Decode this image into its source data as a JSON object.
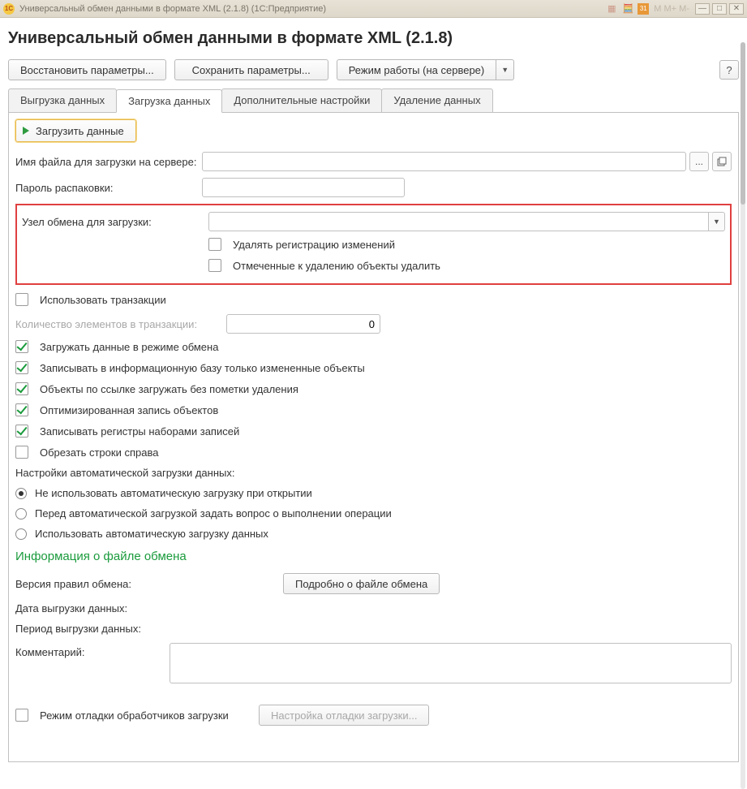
{
  "titlebar": {
    "logo_text": "1C",
    "title": "Универсальный обмен данными в формате XML (2.1.8)  (1С:Предприятие)",
    "m_text": "M  M+ M-"
  },
  "header": {
    "title": "Универсальный обмен данными в формате XML (2.1.8)"
  },
  "toolbar": {
    "restore": "Восстановить параметры...",
    "save": "Сохранить параметры...",
    "mode": "Режим работы (на сервере)",
    "help": "?"
  },
  "tabs": {
    "t1": "Выгрузка данных",
    "t2": "Загрузка данных",
    "t3": "Дополнительные настройки",
    "t4": "Удаление данных"
  },
  "panel": {
    "load_btn": "Загрузить данные",
    "file_label": "Имя файла для загрузки на сервере:",
    "file_value": "",
    "ellipsis": "...",
    "password_label": "Пароль распаковки:",
    "password_value": "",
    "node_label": "Узел обмена для загрузки:",
    "node_value": "",
    "cb_delete_reg": "Удалять регистрацию изменений",
    "cb_delete_marked": "Отмеченные к удалению объекты удалить",
    "cb_use_transactions": "Использовать транзакции",
    "tx_count_label": "Количество элементов в транзакции:",
    "tx_count_value": "0",
    "cb_exchange_mode": "Загружать данные в режиме обмена",
    "cb_record_changed": "Записывать в информационную базу только измененные объекты",
    "cb_load_by_ref": "Объекты по ссылке загружать без пометки удаления",
    "cb_optimized": "Оптимизированная запись объектов",
    "cb_register_sets": "Записывать регистры наборами записей",
    "cb_trim_strings": "Обрезать строки справа",
    "auto_label": "Настройки автоматической загрузки данных:",
    "radio1": "Не использовать автоматическую загрузку при открытии",
    "radio2": "Перед автоматической загрузкой задать вопрос о выполнении операции",
    "radio3": "Использовать автоматическую загрузку данных",
    "green_heading": "Информация о файле обмена",
    "rules_version_label": "Версия правил обмена:",
    "details_btn": "Подробно о файле обмена",
    "export_date_label": "Дата выгрузки данных:",
    "export_period_label": "Период выгрузки данных:",
    "comment_label": "Комментарий:",
    "comment_value": "",
    "cb_debug": "Режим отладки обработчиков загрузки",
    "debug_btn": "Настройка отладки загрузки..."
  }
}
